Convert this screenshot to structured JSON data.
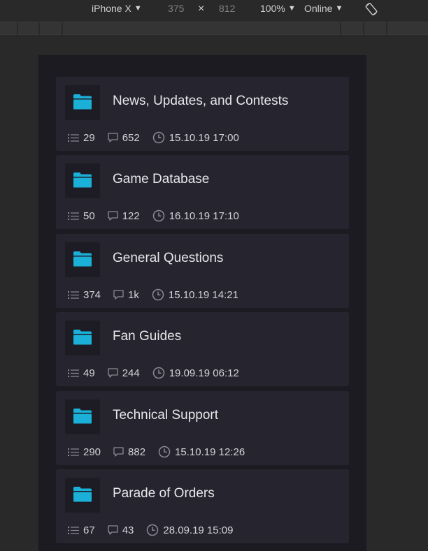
{
  "toolbar": {
    "device": "iPhone X",
    "width": "375",
    "times": "×",
    "height": "812",
    "zoom": "100%",
    "throttle": "Online"
  },
  "forums": [
    {
      "title": "News, Updates, and Contests",
      "topics": "29",
      "messages": "652",
      "last_post": "15.10.19 17:00"
    },
    {
      "title": "Game Database",
      "topics": "50",
      "messages": "122",
      "last_post": "16.10.19 17:10"
    },
    {
      "title": "General Questions",
      "topics": "374",
      "messages": "1k",
      "last_post": "15.10.19 14:21"
    },
    {
      "title": "Fan Guides",
      "topics": "49",
      "messages": "244",
      "last_post": "19.09.19 06:12"
    },
    {
      "title": "Technical Support",
      "topics": "290",
      "messages": "882",
      "last_post": "15.10.19 12:26"
    },
    {
      "title": "Parade of Orders",
      "topics": "67",
      "messages": "43",
      "last_post": "28.09.19 15:09"
    }
  ],
  "colors": {
    "folder": "#1ab0d8",
    "card": "#26252f",
    "frame": "#1b1b21",
    "icon_muted": "#8a8a94"
  },
  "icons": {
    "folder": "folder-icon",
    "topics": "list-icon",
    "messages": "comment-icon",
    "last_post": "clock-icon",
    "rotate": "rotate-icon"
  }
}
